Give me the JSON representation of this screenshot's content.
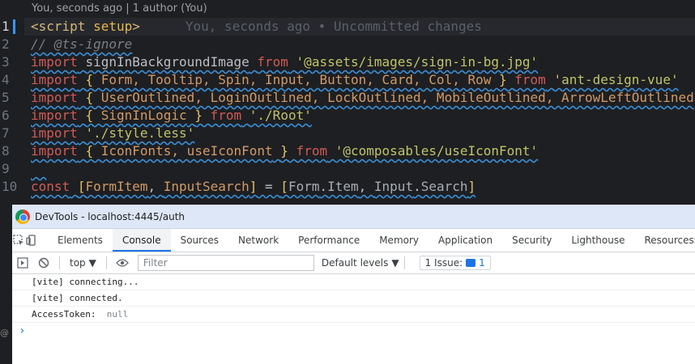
{
  "editor": {
    "codelens": "You, seconds ago | 1 author (You)",
    "line_numbers": [
      "1",
      "2",
      "3",
      "4",
      "5",
      "6",
      "7",
      "8",
      "9",
      "10"
    ],
    "blame": "You, seconds ago • Uncommitted changes",
    "lines": {
      "l1_open": "<script",
      "l1_attr": "setup",
      "l1_close": ">",
      "l2": "// @ts-ignore",
      "l3_kw": "import",
      "l3_id": "signInBackgroundImage",
      "l3_from": "from",
      "l3_str": "'@assets/images/sign-in-bg.jpg'",
      "l4_kw": "import",
      "l4_body": "Form, Tooltip, Spin, Input, Button, Card, Col, Row",
      "l4_from": "from",
      "l4_str": "'ant-design-vue'",
      "l5_kw": "import",
      "l5_body": "UserOutlined, LoginOutlined, LockOutlined, MobileOutlined, ArrowLeftOutlined",
      "l6_kw": "import",
      "l6_body": "SignInLogic",
      "l6_from": "from",
      "l6_str": "'./Root'",
      "l7_kw": "import",
      "l7_str": "'./style.less'",
      "l8_kw": "import",
      "l8_body": "IconFonts, useIconFont",
      "l8_from": "from",
      "l8_str": "'@composables/useIconFont'",
      "l10_kw": "const",
      "l10_a": "FormItem",
      "l10_b": "InputSearch",
      "l10_c": "Form",
      "l10_d": "Item",
      "l10_e": "Input",
      "l10_f": "Search"
    }
  },
  "devtools": {
    "window_title": "DevTools - localhost:4445/auth",
    "tabs": [
      "Elements",
      "Console",
      "Sources",
      "Network",
      "Performance",
      "Memory",
      "Application",
      "Security",
      "Lighthouse",
      "ResourcesSaver"
    ],
    "active_tab": "Console",
    "context": "top",
    "filter_placeholder": "Filter",
    "levels": "Default levels",
    "issues_label": "1 Issue:",
    "issues_count": "1",
    "messages": [
      "[vite] connecting...",
      "[vite] connected."
    ],
    "token_label": "AccessToken:",
    "token_value": "null",
    "prompt": "›"
  },
  "colors": {
    "accent": "#1a73e8",
    "editor_bg": "#1e1f22",
    "keyword": "#cf5b56",
    "string": "#c0c467"
  }
}
